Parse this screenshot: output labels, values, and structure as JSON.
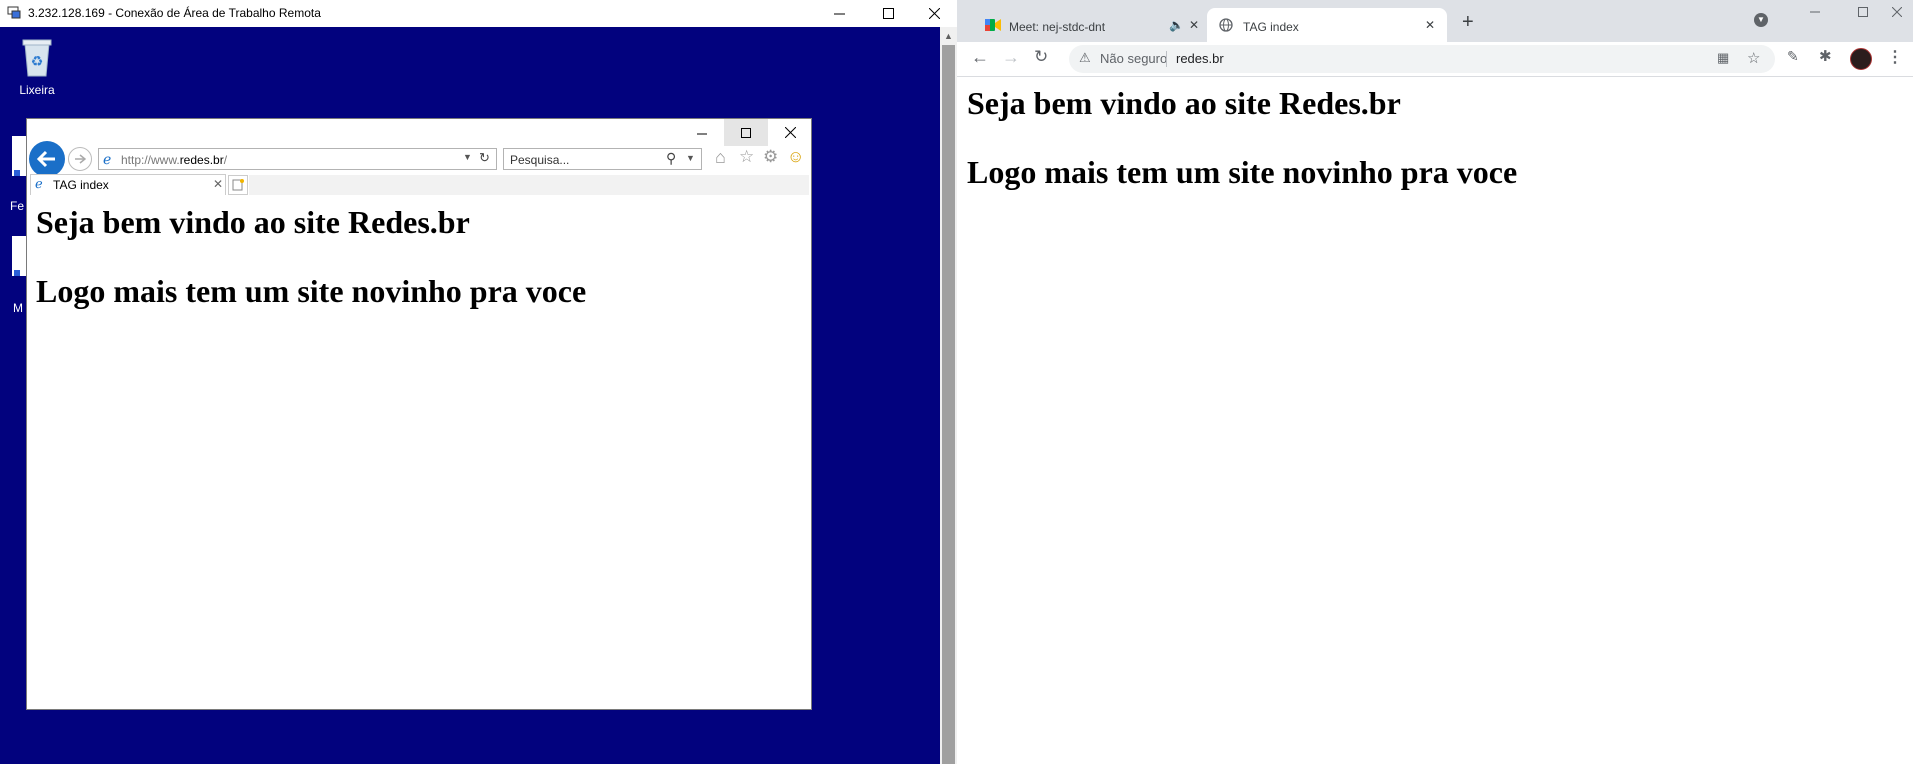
{
  "rdp": {
    "title": "3.232.128.169 - Conexão de Área de Trabalho Remota",
    "controls": {
      "minimize": "—",
      "maximize": "☐",
      "close": "✕"
    },
    "desktop_icons": [
      {
        "label": "Lixeira",
        "icon": "recycle-bin-icon"
      },
      {
        "label": "Fe",
        "icon": "shortcut-icon"
      },
      {
        "label": "M",
        "icon": "shortcut-icon"
      }
    ],
    "desktop_color": "#02027e"
  },
  "ie": {
    "address": "http://www.redes.br/",
    "address_domain": "redes.br",
    "address_prefix": "http://www.",
    "address_suffix": "/",
    "search_placeholder": "Pesquisa...",
    "tab_title": "TAG index",
    "heading1": "Seja bem vindo ao site Redes.br",
    "heading2": "Logo mais tem um site novinho pra voce"
  },
  "chrome": {
    "tabs": [
      {
        "title": "Meet: nej-stdc-dnt",
        "icon": "google-meet-icon",
        "audio": true
      },
      {
        "title": "TAG index",
        "icon": "globe-icon",
        "active": true
      }
    ],
    "security_label": "Não seguro",
    "url": "redes.br",
    "heading1": "Seja bem vindo ao site Redes.br",
    "heading2": "Logo mais tem um site novinho pra voce"
  }
}
